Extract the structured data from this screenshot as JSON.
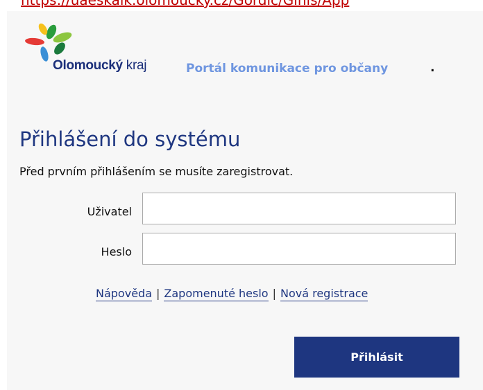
{
  "browser": {
    "url_fragment": "https://uaeskalk.olomoucky.cz/Gordic/Ginis/App"
  },
  "header": {
    "logo_brand": "Olomoucký",
    "logo_suffix": "kraj",
    "portal_title": "Portál komunikace pro občany",
    "portal_dot": "."
  },
  "login": {
    "heading": "Přihlášení do systému",
    "notice": "Před prvním přihlášením se musíte zaregistrovat.",
    "username_label": "Uživatel",
    "username_value": "",
    "password_label": "Heslo",
    "password_value": "",
    "submit_label": "Přihlásit"
  },
  "links": {
    "help": "Nápověda",
    "forgot_password": "Zapomenuté heslo",
    "register": "Nová registrace",
    "separator": "|"
  },
  "colors": {
    "brand_navy": "#1e3680",
    "portal_blue": "#6f96e0",
    "panel_bg": "#f7f7f7"
  }
}
